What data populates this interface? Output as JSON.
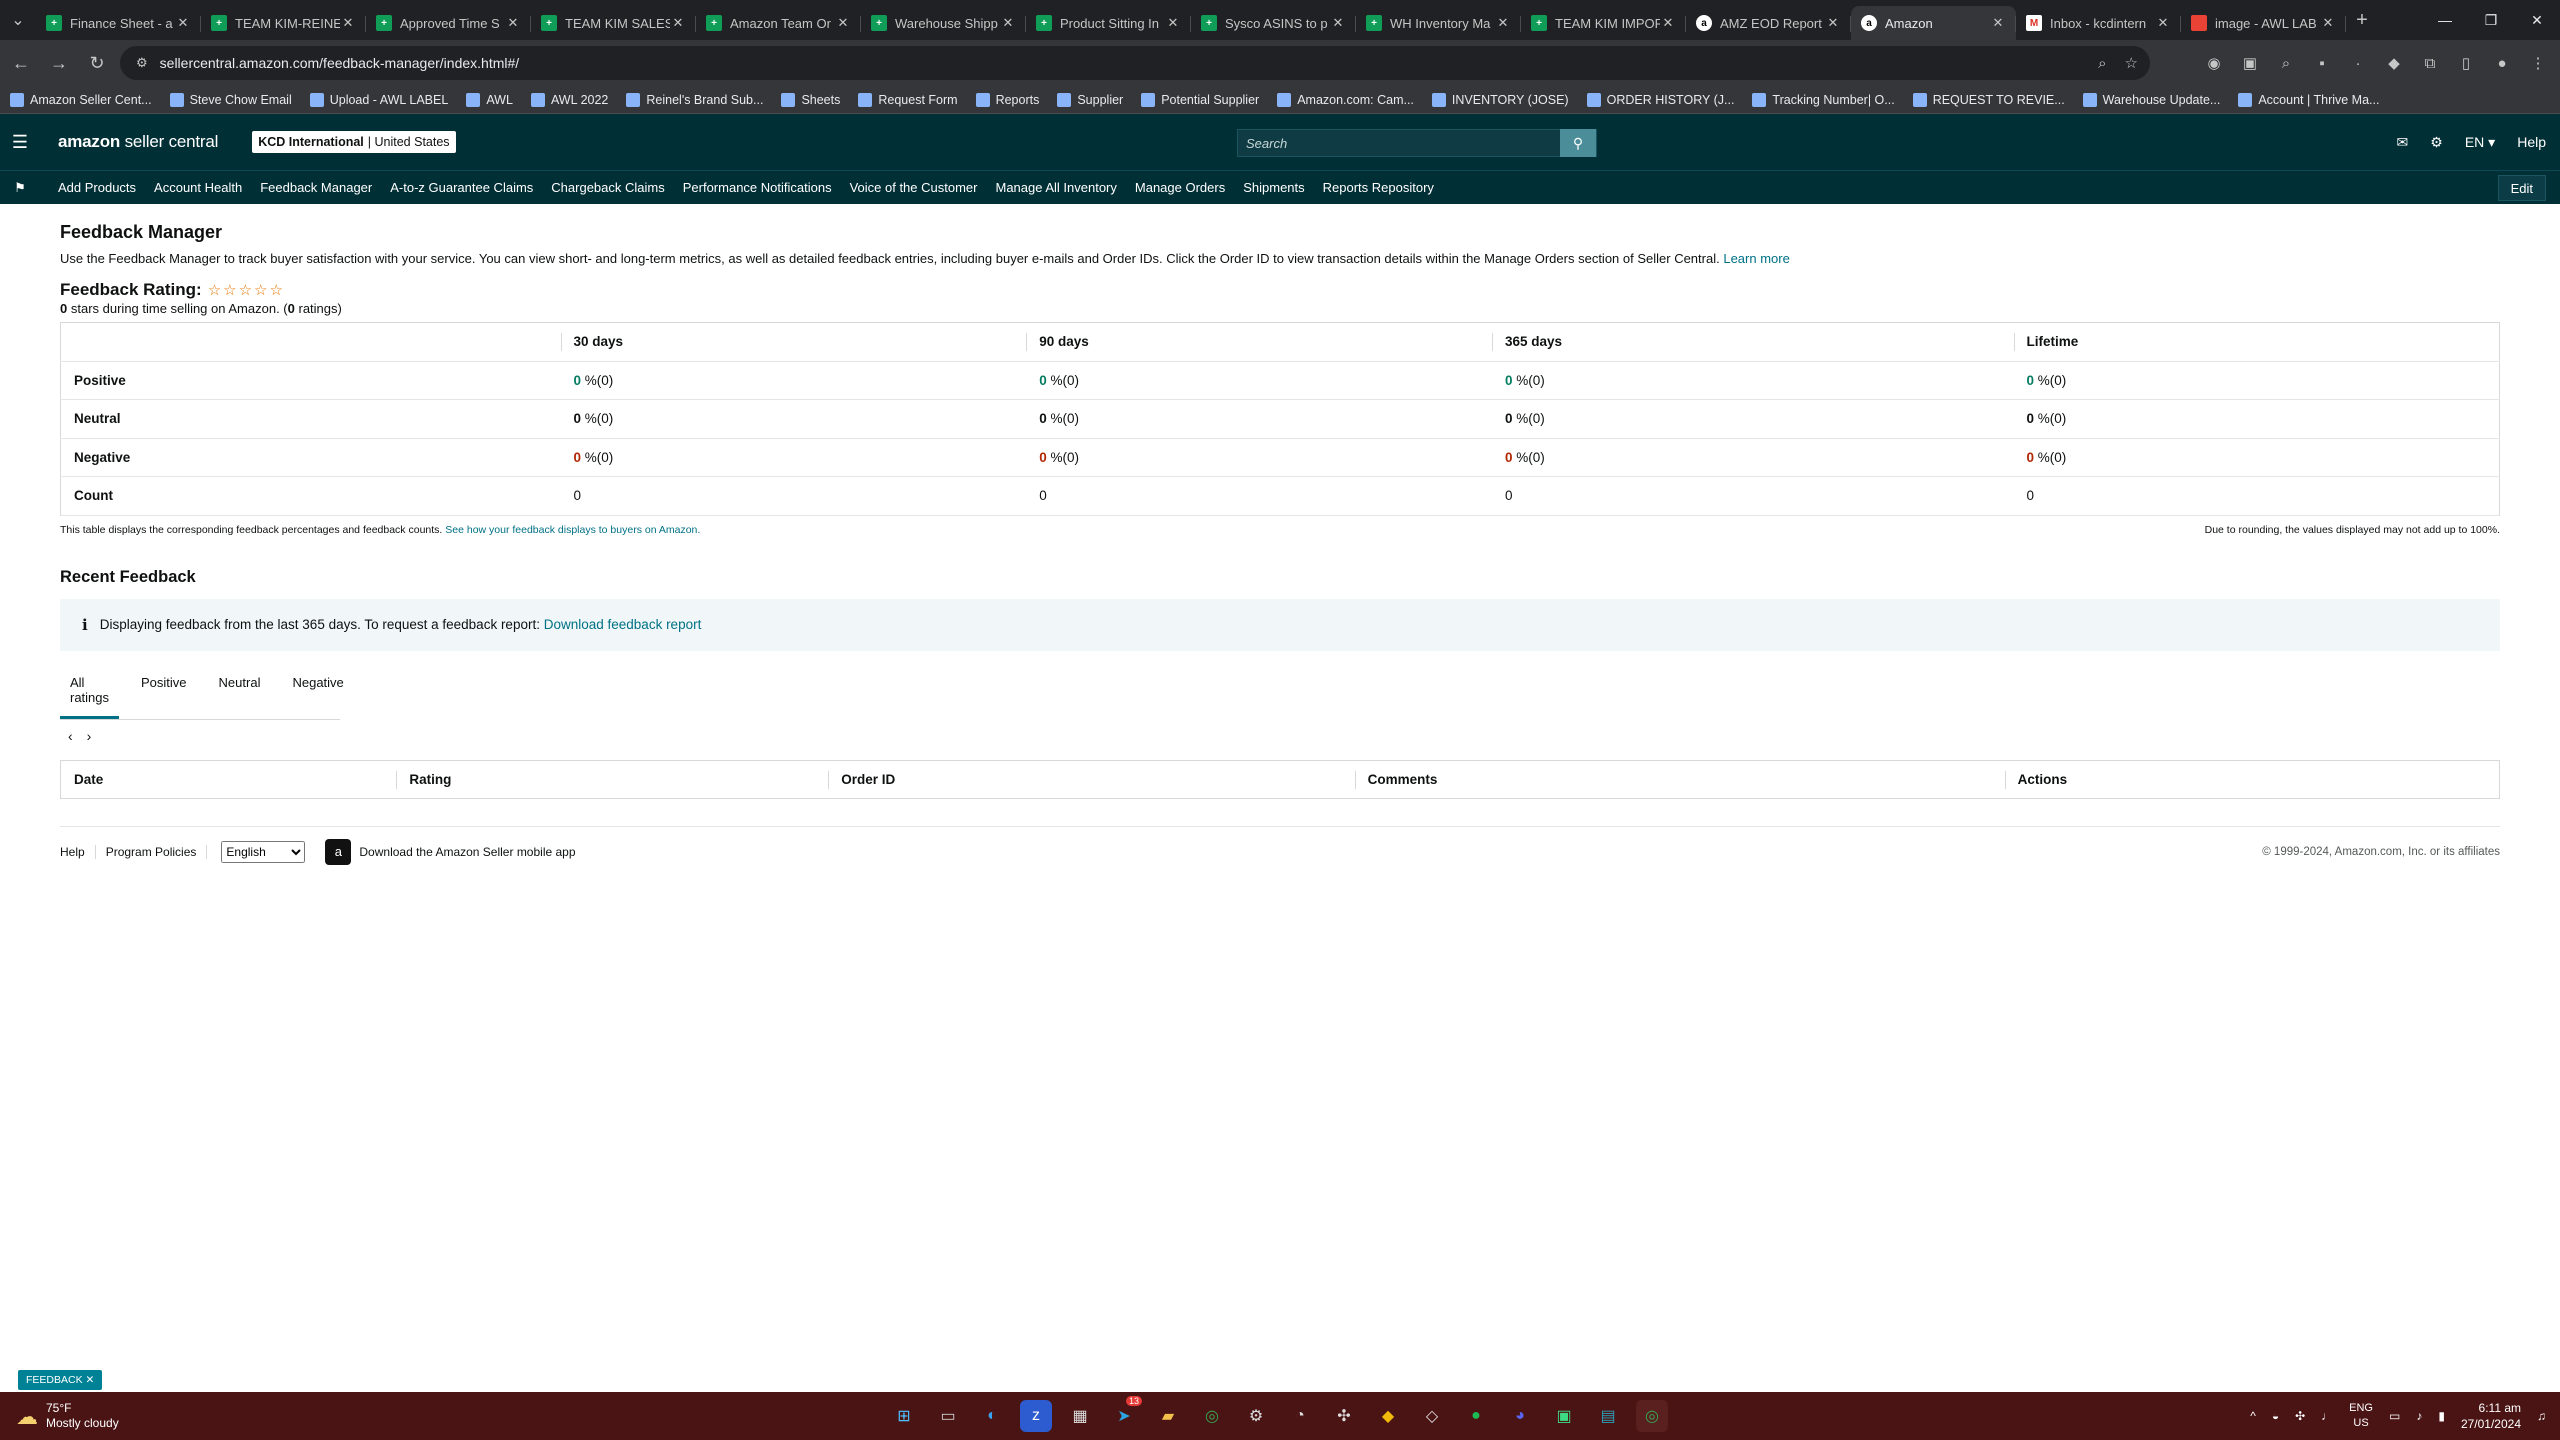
{
  "browser": {
    "tabs": [
      {
        "title": "Finance Sheet - a",
        "icon": "sheets"
      },
      {
        "title": "TEAM KIM-REINE",
        "icon": "sheets"
      },
      {
        "title": "Approved Time S",
        "icon": "sheets"
      },
      {
        "title": "TEAM KIM SALES",
        "icon": "sheets"
      },
      {
        "title": "Amazon Team Or",
        "icon": "sheets"
      },
      {
        "title": "Warehouse Shipp",
        "icon": "sheets"
      },
      {
        "title": "Product Sitting In",
        "icon": "sheets"
      },
      {
        "title": "Sysco ASINS to p",
        "icon": "sheets"
      },
      {
        "title": "WH Inventory Ma",
        "icon": "sheets"
      },
      {
        "title": "TEAM KIM IMPOR",
        "icon": "sheets"
      },
      {
        "title": "AMZ EOD Report",
        "icon": "amz"
      },
      {
        "title": "Amazon",
        "icon": "amz"
      },
      {
        "title": "Inbox - kcdintern",
        "icon": "gmail"
      },
      {
        "title": "image - AWL LAB",
        "icon": "pdf"
      }
    ],
    "url": "sellercentral.amazon.com/feedback-manager/index.html#/",
    "bookmarks": [
      "Amazon Seller Cent...",
      "Steve Chow Email",
      "Upload - AWL LABEL",
      "AWL",
      "AWL 2022",
      "Reinel's Brand Sub...",
      "Sheets",
      "Request Form",
      "Reports",
      "Supplier",
      "Potential Supplier",
      "Amazon.com: Cam...",
      "INVENTORY (JOSE)",
      "ORDER HISTORY (J...",
      "Tracking Number| O...",
      "REQUEST TO REVIE...",
      "Warehouse Update...",
      "Account | Thrive Ma..."
    ]
  },
  "header": {
    "logo_brand": "amazon",
    "logo_product": "seller central",
    "account_name": "KCD International",
    "account_region": "United States",
    "search_placeholder": "Search",
    "language": "EN",
    "help": "Help"
  },
  "nav": {
    "items": [
      "Add Products",
      "Account Health",
      "Feedback Manager",
      "A-to-z Guarantee Claims",
      "Chargeback Claims",
      "Performance Notifications",
      "Voice of the Customer",
      "Manage All Inventory",
      "Manage Orders",
      "Shipments",
      "Reports Repository"
    ],
    "edit": "Edit"
  },
  "page": {
    "title": "Feedback Manager",
    "description": "Use the Feedback Manager to track buyer satisfaction with your service. You can view short- and long-term metrics, as well as detailed feedback entries, including buyer e-mails and Order IDs. Click the Order ID to view transaction details within the Manage Orders section of Seller Central.",
    "learn_more": "Learn more",
    "rating_label": "Feedback Rating:",
    "stars": 0,
    "stars_max": 5,
    "rating_count_stars": "0",
    "rating_sub_mid": "stars during time selling on Amazon. (",
    "rating_count": "0",
    "rating_sub_end": "ratings)"
  },
  "feedback_table": {
    "columns": [
      "30 days",
      "90 days",
      "365 days",
      "Lifetime"
    ],
    "rows": [
      {
        "label": "Positive",
        "kind": "pos",
        "values": [
          "0",
          "0",
          "0",
          "0"
        ],
        "suffix": "%(0)"
      },
      {
        "label": "Neutral",
        "kind": "neu",
        "values": [
          "0",
          "0",
          "0",
          "0"
        ],
        "suffix": "%(0)"
      },
      {
        "label": "Negative",
        "kind": "neg",
        "values": [
          "0",
          "0",
          "0",
          "0"
        ],
        "suffix": "%(0)"
      },
      {
        "label": "Count",
        "kind": "plain",
        "values": [
          "0",
          "0",
          "0",
          "0"
        ],
        "suffix": ""
      }
    ],
    "note_left": "This table displays the corresponding feedback percentages and feedback counts.",
    "note_link": "See how your feedback displays to buyers on Amazon.",
    "note_right": "Due to rounding, the values displayed may not add up to 100%."
  },
  "recent": {
    "title": "Recent Feedback",
    "info_text": "Displaying feedback from the last 365 days. To request a feedback report:",
    "info_link": "Download feedback report",
    "tabs": [
      "All ratings",
      "Positive",
      "Neutral",
      "Negative"
    ],
    "active_tab": 0,
    "columns": [
      "Date",
      "Rating",
      "Order ID",
      "Comments",
      "Actions"
    ]
  },
  "footer": {
    "help": "Help",
    "policies": "Program Policies",
    "language_selected": "English",
    "app_text": "Download the Amazon Seller mobile app",
    "copyright": "© 1999-2024, Amazon.com, Inc. or its affiliates"
  },
  "feedback_pill": "FEEDBACK",
  "taskbar": {
    "temperature": "75°F",
    "weather": "Mostly cloudy",
    "lang_top": "ENG",
    "lang_bottom": "US",
    "time": "6:11 am",
    "date": "27/01/2024",
    "badge": "13"
  }
}
